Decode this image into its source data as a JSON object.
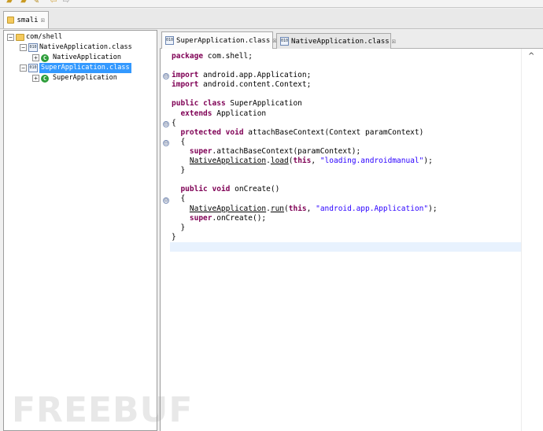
{
  "toolbar": {
    "icons": [
      "open-folder-icon",
      "open-file-icon",
      "wand-icon",
      "back-icon",
      "forward-icon"
    ]
  },
  "left_panel": {
    "tab_label": "smali",
    "tab_close": "☒",
    "tree": {
      "root": {
        "label": "com/shell",
        "toggle": "−"
      },
      "items": [
        {
          "label": "NativeApplication.class",
          "toggle": "−",
          "icon": "class-file-icon"
        },
        {
          "label": "NativeApplication",
          "toggle": "+",
          "icon": "class-c-icon",
          "glyph": "C"
        },
        {
          "label": "SuperApplication.class",
          "toggle": "−",
          "icon": "class-file-icon"
        },
        {
          "label": "SuperApplication",
          "toggle": "+",
          "icon": "class-c-icon",
          "glyph": "C"
        }
      ]
    }
  },
  "editor": {
    "tabs": [
      {
        "label": "SuperApplication.class",
        "close": "☒",
        "active": true
      },
      {
        "label": "NativeApplication.class",
        "close": "☒",
        "active": false
      }
    ],
    "code": {
      "l1_kw": "package",
      "l1_rest": " com.shell;",
      "l3_kw": "import",
      "l3_rest": " android.app.Application;",
      "l4_kw": "import",
      "l4_rest": " android.content.Context;",
      "l6_kw1": "public",
      "l6_kw2": "class",
      "l6_rest": " SuperApplication",
      "l7_kw": "extends",
      "l7_rest": " Application",
      "l8": "{",
      "l9_kw1": "protected",
      "l9_kw2": "void",
      "l9_rest": " attachBaseContext(Context paramContext)",
      "l10": "{",
      "l11_kw": "super",
      "l11_rest": ".attachBaseContext(paramContext);",
      "l12_a": "NativeApplication",
      "l12_b": ".",
      "l12_c": "load",
      "l12_d": "(",
      "l12_kw": "this",
      "l12_e": ", ",
      "l12_str": "\"loading.androidmanual\"",
      "l12_f": ");",
      "l13": "}",
      "l15_kw1": "public",
      "l15_kw2": "void",
      "l15_rest": " onCreate()",
      "l16": "{",
      "l17_a": "NativeApplication",
      "l17_b": ".",
      "l17_c": "run",
      "l17_d": "(",
      "l17_kw": "this",
      "l17_e": ", ",
      "l17_str": "\"android.app.Application\"",
      "l17_f": ");",
      "l18_kw": "super",
      "l18_rest": ".onCreate();",
      "l19": "}",
      "l20": "}"
    },
    "fold_markers": [
      "⊖",
      "⊖",
      "⊖",
      "⊖"
    ],
    "scroll_up": "^"
  },
  "watermark": "FREEBUF",
  "colors": {
    "keyword": "#7f0055",
    "string": "#2a00ff",
    "selection": "#3399ff",
    "current_line": "#e8f2fe"
  }
}
